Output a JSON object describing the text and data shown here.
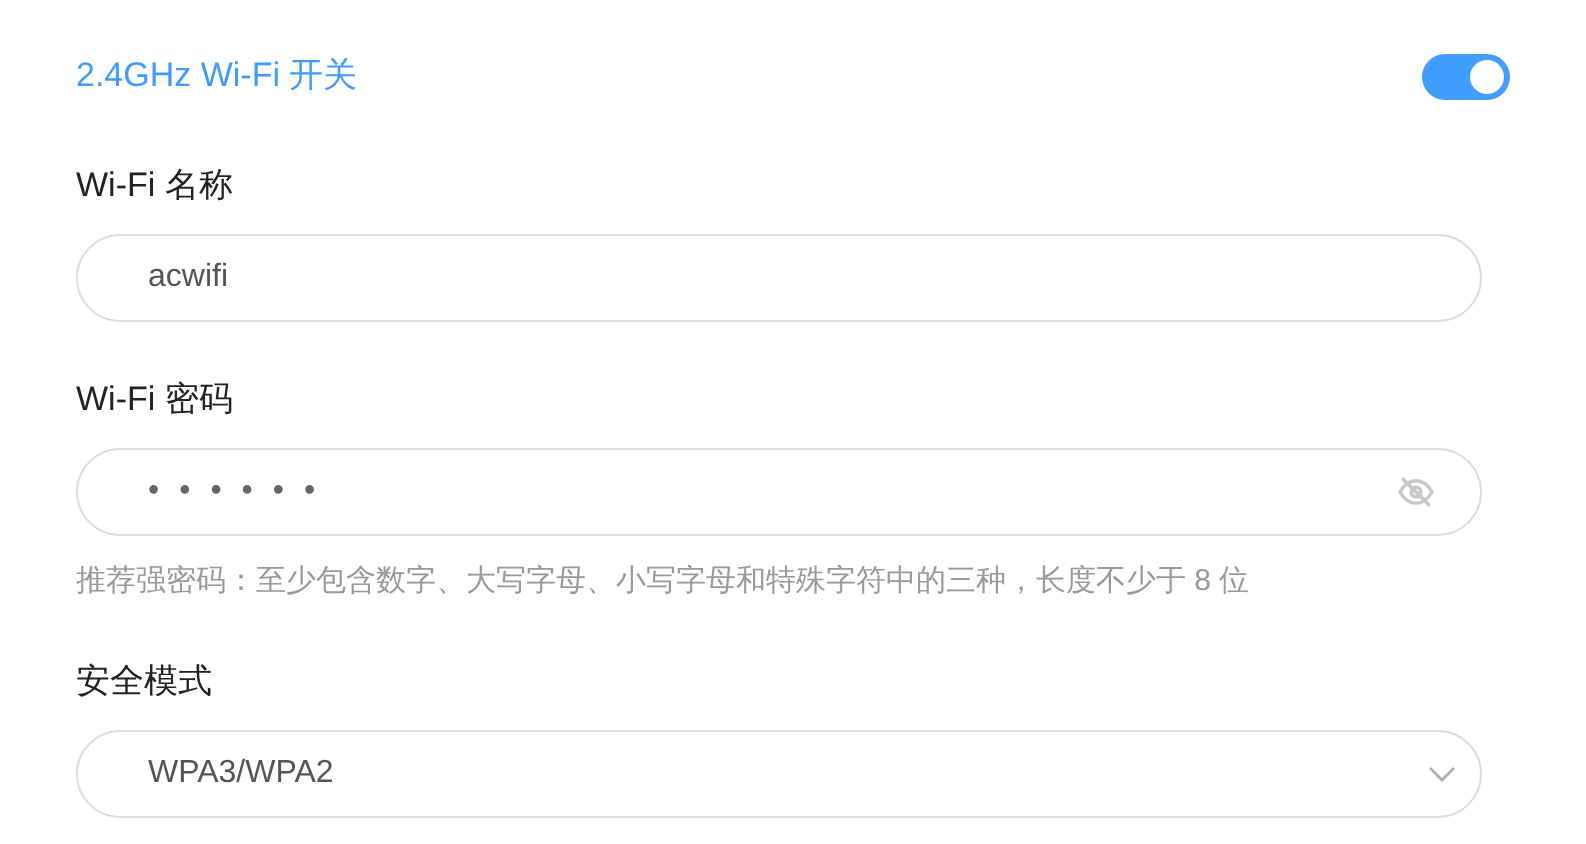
{
  "wifi_switch": {
    "label": "2.4GHz Wi-Fi 开关",
    "on": true
  },
  "fields": [
    {
      "kind": "text",
      "label": "Wi-Fi 名称",
      "value": "acwifi"
    },
    {
      "kind": "password",
      "label": "Wi-Fi 密码",
      "value": "••••••",
      "hint": "推荐强密码：至少包含数字、大写字母、小写字母和特殊字符中的三种，长度不少于 8 位"
    },
    {
      "kind": "select",
      "label": "安全模式",
      "value": "WPA3/WPA2"
    }
  ]
}
